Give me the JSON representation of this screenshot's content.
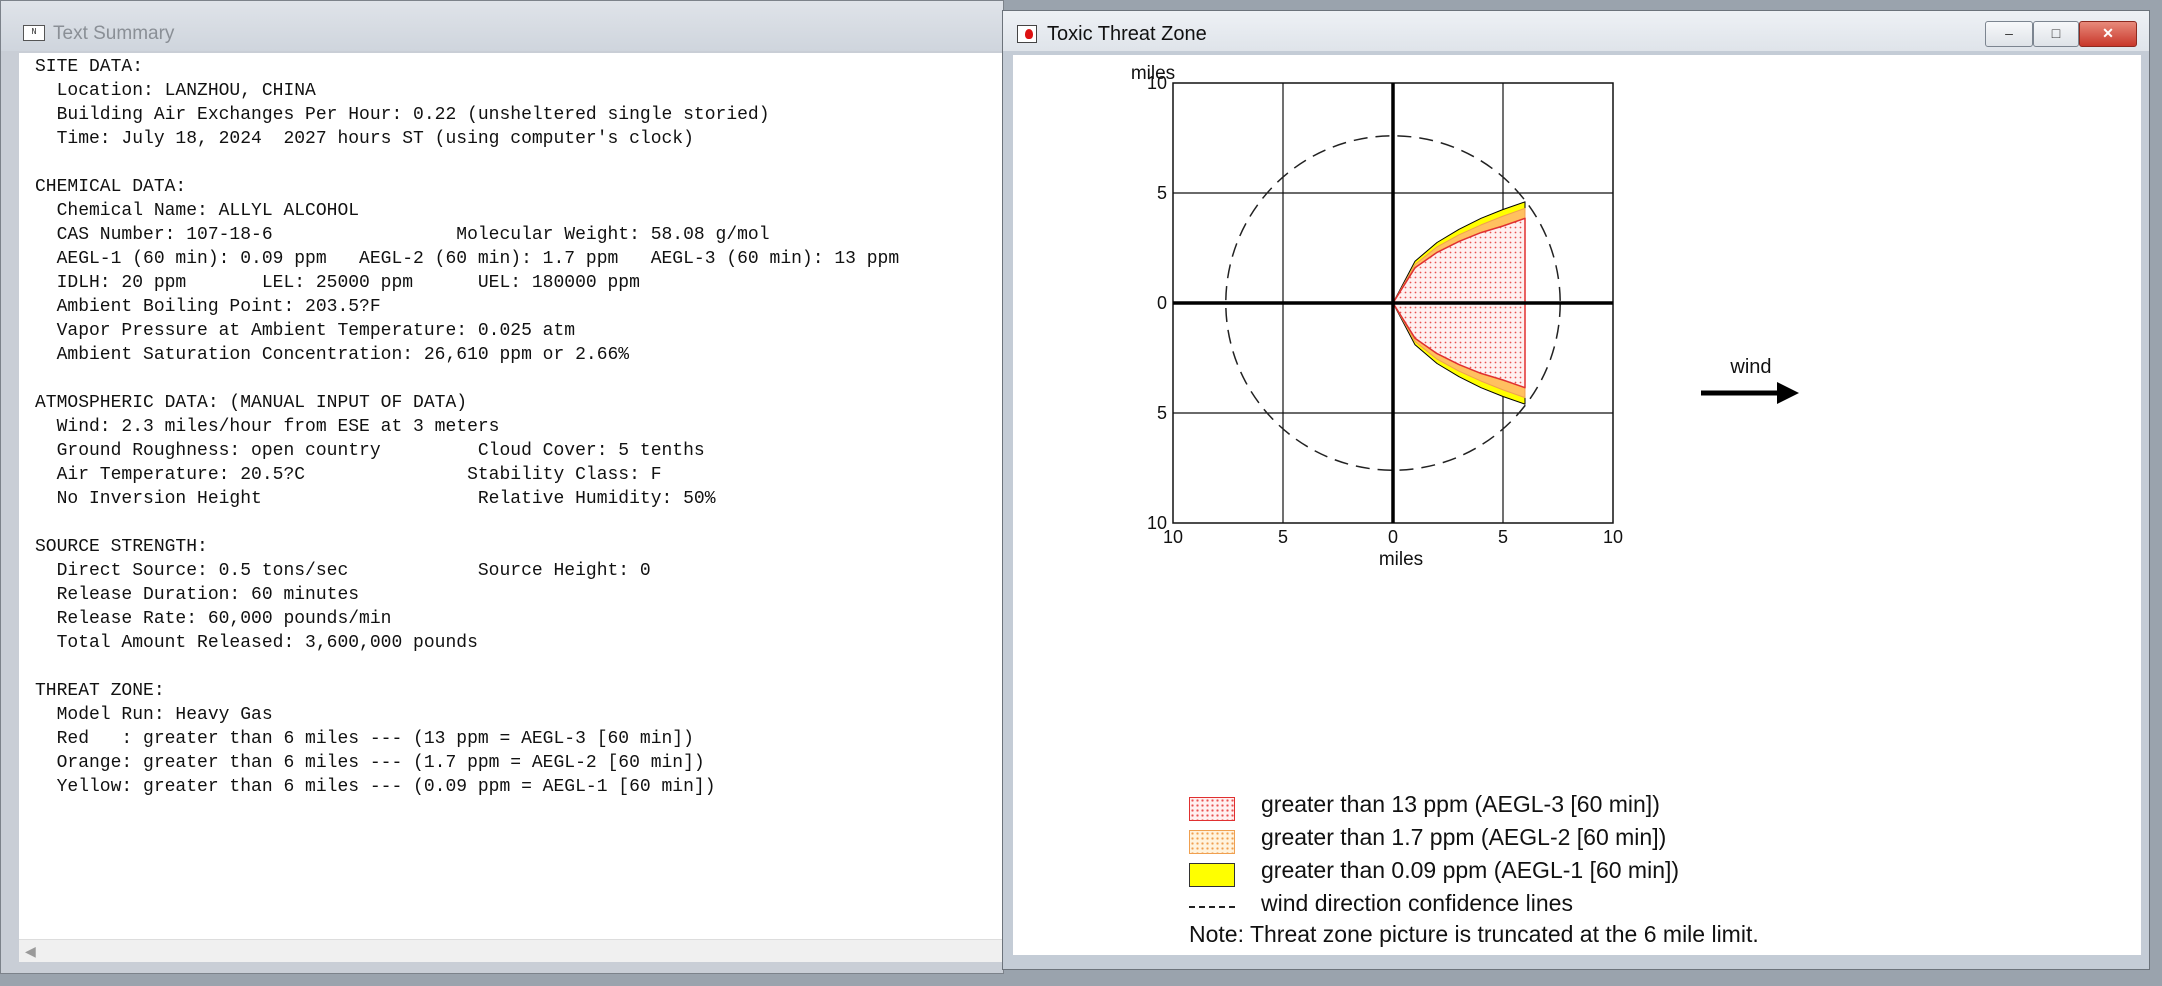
{
  "text_window": {
    "title": "Text Summary",
    "lines": [
      "SITE DATA:",
      "  Location: LANZHOU, CHINA",
      "  Building Air Exchanges Per Hour: 0.22 (unsheltered single storied)",
      "  Time: July 18, 2024  2027 hours ST (using computer's clock)",
      "",
      "CHEMICAL DATA:",
      "  Chemical Name: ALLYL ALCOHOL",
      "  CAS Number: 107-18-6                 Molecular Weight: 58.08 g/mol",
      "  AEGL-1 (60 min): 0.09 ppm   AEGL-2 (60 min): 1.7 ppm   AEGL-3 (60 min): 13 ppm",
      "  IDLH: 20 ppm       LEL: 25000 ppm      UEL: 180000 ppm",
      "  Ambient Boiling Point: 203.5?F",
      "  Vapor Pressure at Ambient Temperature: 0.025 atm",
      "  Ambient Saturation Concentration: 26,610 ppm or 2.66%",
      "",
      "ATMOSPHERIC DATA: (MANUAL INPUT OF DATA)",
      "  Wind: 2.3 miles/hour from ESE at 3 meters",
      "  Ground Roughness: open country         Cloud Cover: 5 tenths",
      "  Air Temperature: 20.5?C               Stability Class: F",
      "  No Inversion Height                    Relative Humidity: 50%",
      "",
      "SOURCE STRENGTH:",
      "  Direct Source: 0.5 tons/sec            Source Height: 0",
      "  Release Duration: 60 minutes",
      "  Release Rate: 60,000 pounds/min",
      "  Total Amount Released: 3,600,000 pounds",
      "",
      "THREAT ZONE:",
      "  Model Run: Heavy Gas",
      "  Red   : greater than 6 miles --- (13 ppm = AEGL-3 [60 min])",
      "  Orange: greater than 6 miles --- (1.7 ppm = AEGL-2 [60 min])",
      "  Yellow: greater than 6 miles --- (0.09 ppm = AEGL-1 [60 min])"
    ]
  },
  "zone_window": {
    "title": "Toxic Threat Zone",
    "controls": {
      "minimize": "–",
      "maximize": "□",
      "close": "✕"
    },
    "legend": [
      {
        "swatch": "red",
        "label": "greater than 13 ppm (AEGL-3 [60 min])"
      },
      {
        "swatch": "orange",
        "label": "greater than 1.7 ppm (AEGL-2 [60 min])"
      },
      {
        "swatch": "yellow",
        "label": "greater than 0.09 ppm (AEGL-1 [60 min])"
      },
      {
        "swatch": "dash",
        "label": "wind direction confidence lines"
      }
    ],
    "note": "Note: Threat zone picture is truncated at the 6 mile limit.",
    "wind_label": "wind"
  },
  "chart_data": {
    "type": "area",
    "xlabel": "miles",
    "ylabel": "miles",
    "xlim": [
      -10,
      10
    ],
    "ylim": [
      -10,
      10
    ],
    "x_tick_labels": [
      "10",
      "5",
      "0",
      "5",
      "10"
    ],
    "y_tick_labels": [
      "10",
      "5",
      "0",
      "5",
      "10"
    ],
    "grid": true,
    "truncation_x": 6,
    "confidence_circle_radius": 7.6,
    "series": [
      {
        "name": "greater than 0.09 ppm (AEGL-1 [60 min])",
        "color": "#ffff00",
        "x": [
          0,
          1,
          2,
          3,
          4,
          5,
          6
        ],
        "y_half_width": [
          0,
          1.9,
          2.75,
          3.35,
          3.85,
          4.25,
          4.6
        ]
      },
      {
        "name": "greater than 1.7 ppm (AEGL-2 [60 min])",
        "color": "#ffb347",
        "x": [
          0,
          1,
          2,
          3,
          4,
          5,
          6
        ],
        "y_half_width": [
          0,
          1.75,
          2.55,
          3.1,
          3.55,
          3.95,
          4.3
        ]
      },
      {
        "name": "greater than 13 ppm (AEGL-3 [60 min])",
        "color": "#e03030",
        "x": [
          0,
          1,
          2,
          3,
          4,
          5,
          6
        ],
        "y_half_width": [
          0,
          1.6,
          2.3,
          2.8,
          3.2,
          3.5,
          3.85
        ]
      }
    ]
  }
}
